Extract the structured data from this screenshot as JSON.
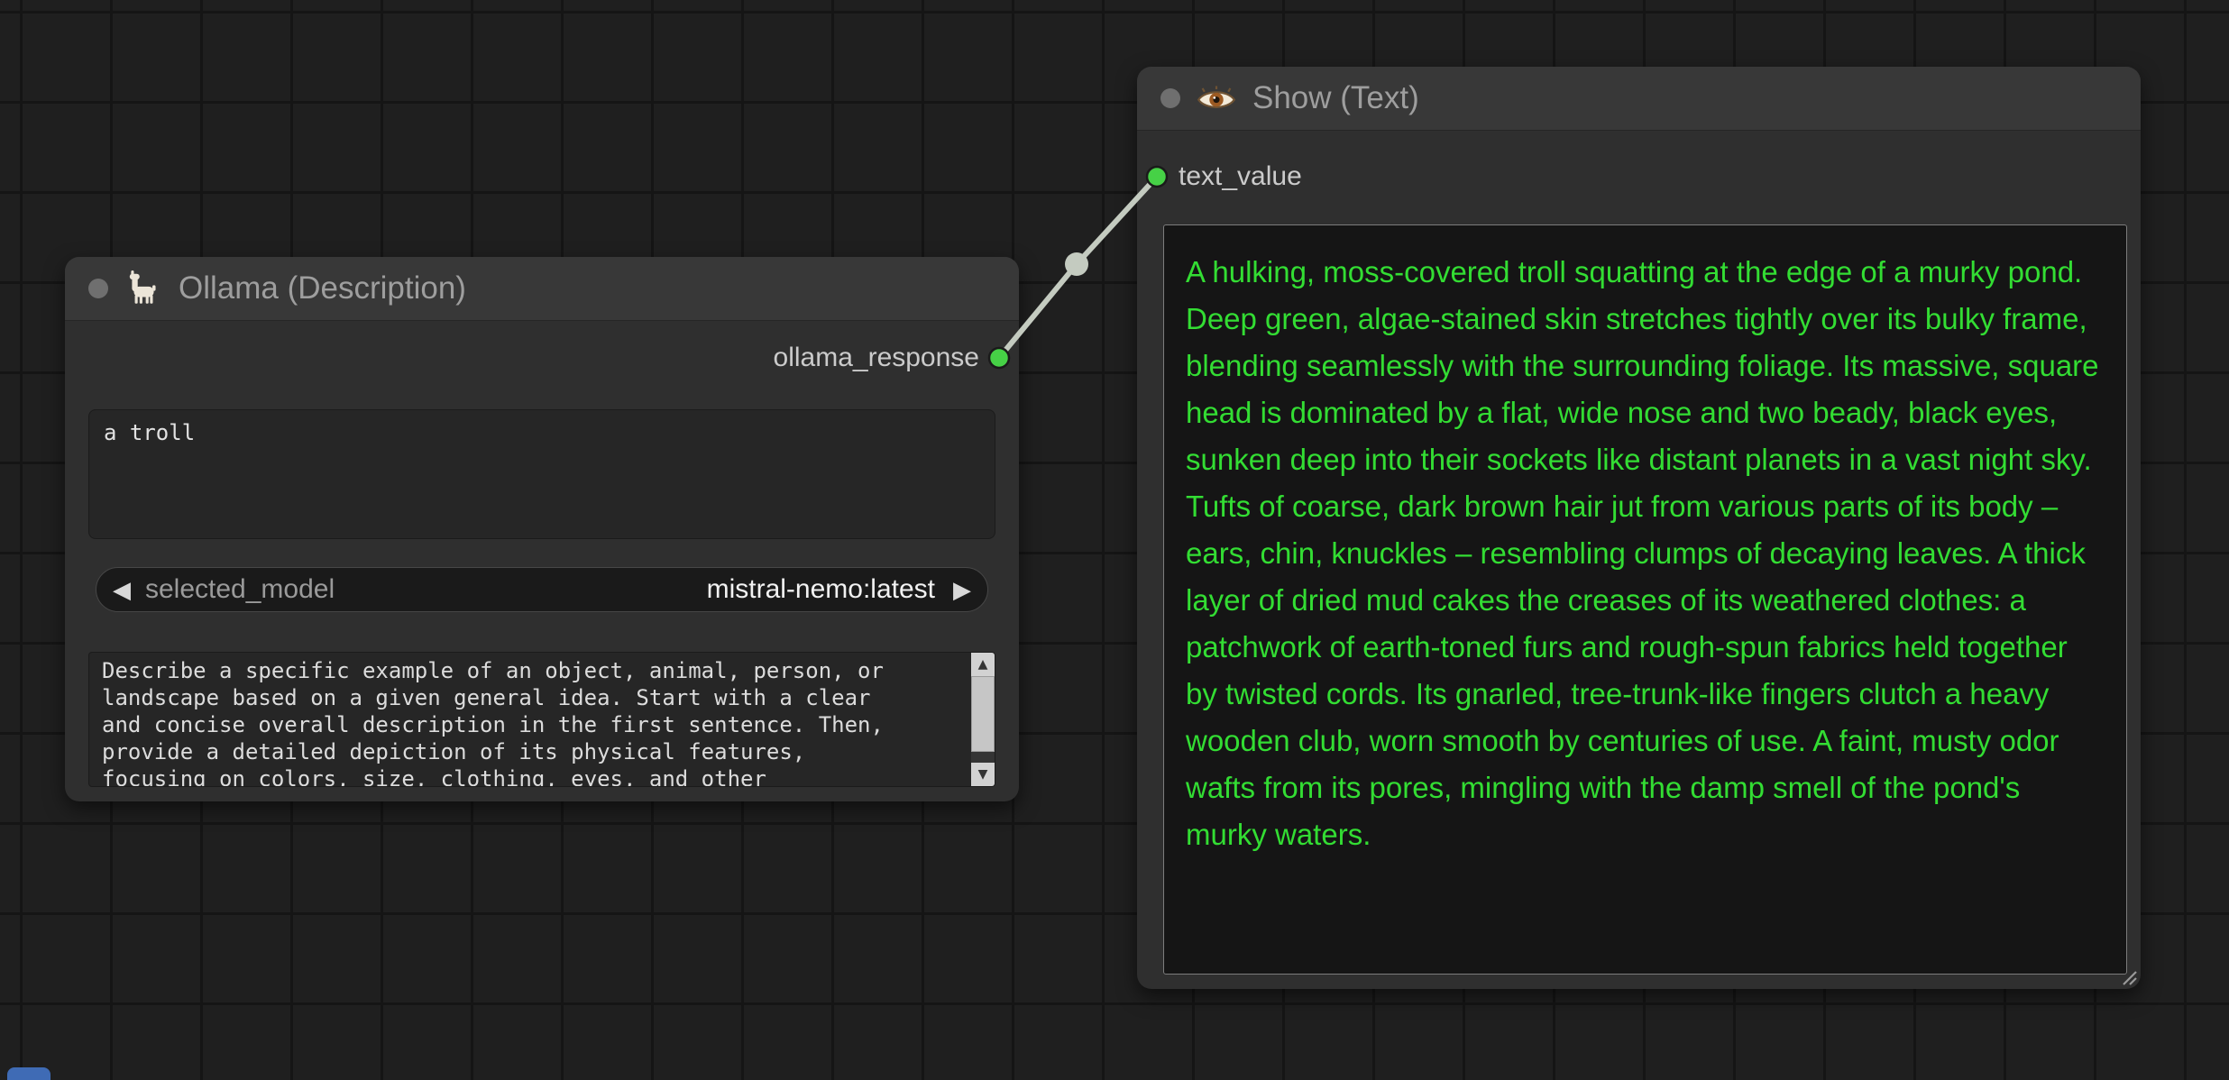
{
  "canvas": {
    "background": "#1f1f1f",
    "grid_line": "#151515"
  },
  "colors": {
    "slot_green": "#46d146",
    "link": "#c4cbc0",
    "node_body": "#2f2f2f",
    "node_header": "#383838",
    "show_text_green": "#33dd33",
    "offscreen_node": "#3f6bb5"
  },
  "nodes": {
    "ollama": {
      "title": "Ollama (Description)",
      "icon": "llama-icon",
      "output_slot": {
        "label": "ollama_response"
      },
      "prompt_input": {
        "value": "a troll"
      },
      "model_widget": {
        "label": "selected_model",
        "value": "mistral-nemo:latest",
        "prev_arrow": "◀",
        "next_arrow": "▶"
      },
      "system_prompt": {
        "visible_text": "Describe a specific example of an object, animal, person, or\nlandscape based on a given general idea. Start with a clear\nand concise overall description in the first sentence. Then,\nprovide a detailed depiction of its physical features,\nfocusing on colors, size, clothing, eyes, and other"
      },
      "scrollbar": {
        "up_arrow": "▲",
        "down_arrow": "▼"
      }
    },
    "show_text": {
      "title": "Show (Text)",
      "icon": "eye-icon",
      "input_slot": {
        "label": "text_value"
      },
      "text_value": "A hulking, moss-covered troll squatting at the edge of a murky pond. Deep green, algae-stained skin stretches tightly over its bulky frame, blending seamlessly with the surrounding foliage. Its massive, square head is dominated by a flat, wide nose and two beady, black eyes, sunken deep into their sockets like distant planets in a vast night sky. Tufts of coarse, dark brown hair jut from various parts of its body – ears, chin, knuckles – resembling clumps of decaying leaves. A thick layer of dried mud cakes the creases of its weathered clothes: a patchwork of earth-toned furs and rough-spun fabrics held together by twisted cords. Its gnarled, tree-trunk-like fingers clutch a heavy wooden club, worn smooth by centuries of use. A faint, musty odor wafts from its pores, mingling with the damp smell of the pond's murky waters."
    }
  }
}
